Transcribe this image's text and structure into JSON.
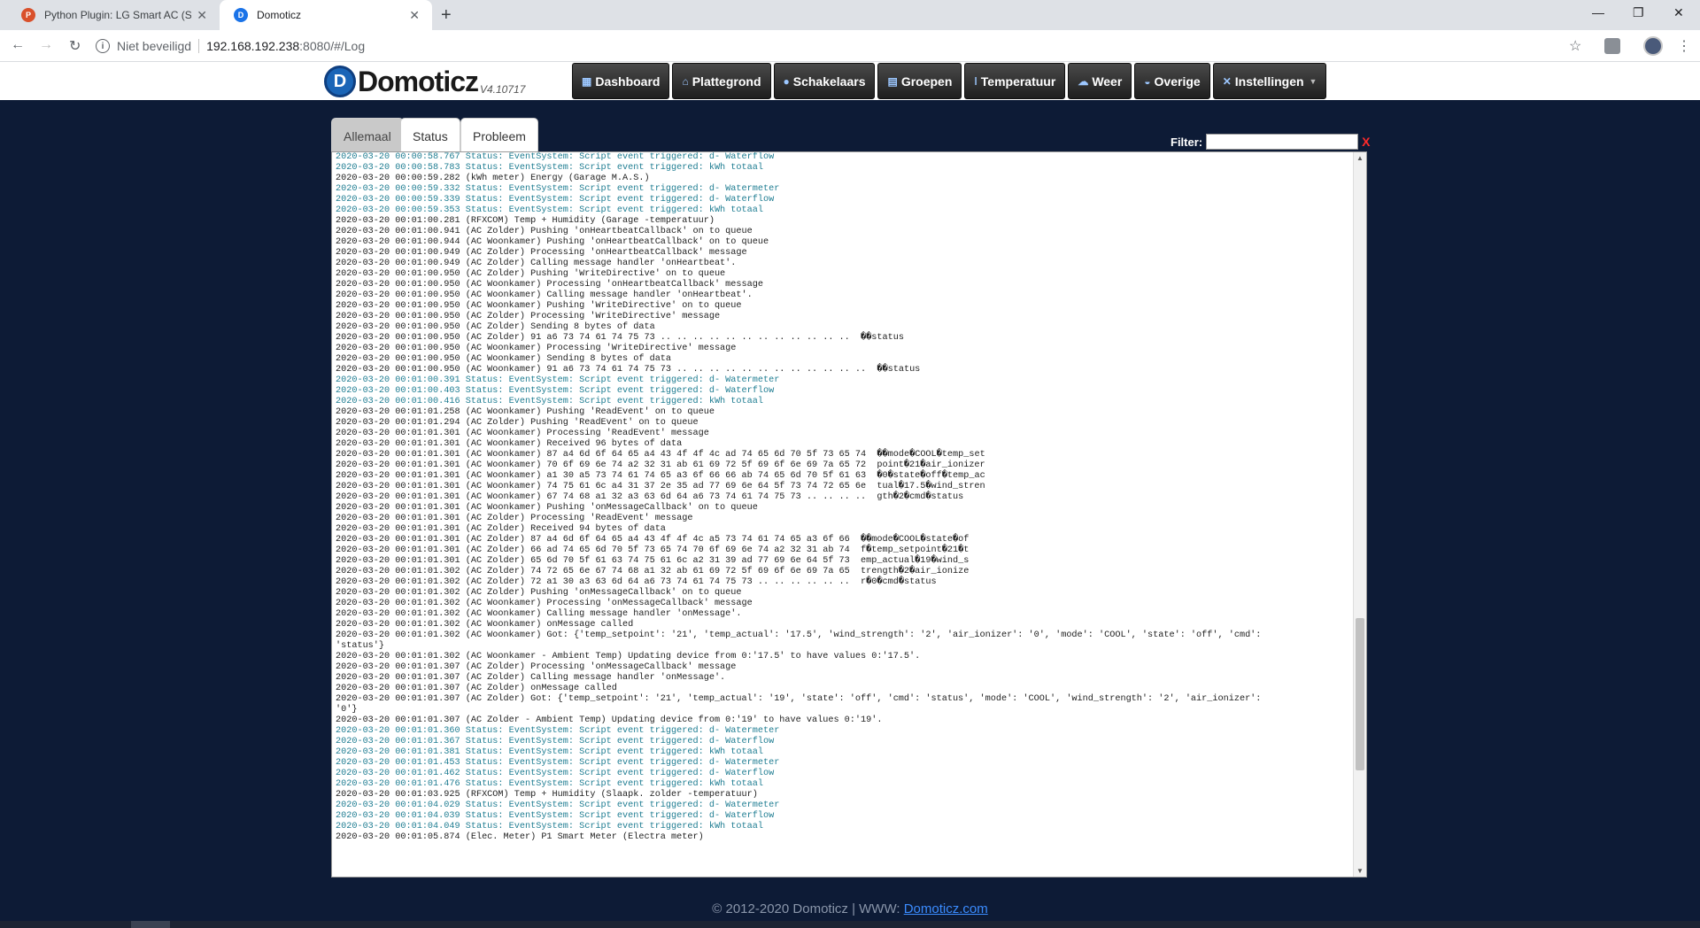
{
  "browser": {
    "tabs": [
      {
        "title": "Python Plugin: LG Smart AC (Sm",
        "favicon_color": "#d9502b"
      },
      {
        "title": "Domoticz",
        "favicon_color": "#1a73e8"
      }
    ],
    "address": {
      "security": "Niet beveiligd",
      "host": "192.168.192.238",
      "path": ":8080/#/Log"
    }
  },
  "header": {
    "logo": "Domoticz",
    "version": "V4.10717",
    "nav": [
      {
        "label": "Dashboard",
        "icon": "dashboard-icon",
        "glyph": "▦"
      },
      {
        "label": "Plattegrond",
        "icon": "floorplan-icon",
        "glyph": "⌂"
      },
      {
        "label": "Schakelaars",
        "icon": "lightbulb-icon",
        "glyph": "●"
      },
      {
        "label": "Groepen",
        "icon": "scenes-icon",
        "glyph": "▤"
      },
      {
        "label": "Temperatuur",
        "icon": "thermometer-icon",
        "glyph": "ǀ"
      },
      {
        "label": "Weer",
        "icon": "weather-icon",
        "glyph": "☁"
      },
      {
        "label": "Overige",
        "icon": "utility-icon",
        "glyph": "◒"
      },
      {
        "label": "Instellingen",
        "icon": "settings-icon",
        "glyph": "✕",
        "dropdown": true
      }
    ]
  },
  "log": {
    "tabs": [
      "Allemaal",
      "Status",
      "Probleem"
    ],
    "active_tab": 0,
    "filter_label": "Filter:",
    "filter_value": "",
    "clear_label": "X",
    "status_color": "#1f7d92",
    "lines": [
      {
        "t": "2020-03-20 00:00:58.767 Status: EventSystem: Script event triggered: d- Waterflow",
        "s": true
      },
      {
        "t": "2020-03-20 00:00:58.783 Status: EventSystem: Script event triggered: kWh totaal",
        "s": true
      },
      {
        "t": "2020-03-20 00:00:59.282 (kWh meter) Energy (Garage M.A.S.)",
        "s": false
      },
      {
        "t": "2020-03-20 00:00:59.332 Status: EventSystem: Script event triggered: d- Watermeter",
        "s": true
      },
      {
        "t": "2020-03-20 00:00:59.339 Status: EventSystem: Script event triggered: d- Waterflow",
        "s": true
      },
      {
        "t": "2020-03-20 00:00:59.353 Status: EventSystem: Script event triggered: kWh totaal",
        "s": true
      },
      {
        "t": "2020-03-20 00:01:00.281 (RFXCOM) Temp + Humidity (Garage -temperatuur)",
        "s": false
      },
      {
        "t": "2020-03-20 00:01:00.941 (AC Zolder) Pushing 'onHeartbeatCallback' on to queue",
        "s": false
      },
      {
        "t": "2020-03-20 00:01:00.944 (AC Woonkamer) Pushing 'onHeartbeatCallback' on to queue",
        "s": false
      },
      {
        "t": "2020-03-20 00:01:00.949 (AC Zolder) Processing 'onHeartbeatCallback' message",
        "s": false
      },
      {
        "t": "2020-03-20 00:01:00.949 (AC Zolder) Calling message handler 'onHeartbeat'.",
        "s": false
      },
      {
        "t": "2020-03-20 00:01:00.950 (AC Zolder) Pushing 'WriteDirective' on to queue",
        "s": false
      },
      {
        "t": "2020-03-20 00:01:00.950 (AC Woonkamer) Processing 'onHeartbeatCallback' message",
        "s": false
      },
      {
        "t": "2020-03-20 00:01:00.950 (AC Woonkamer) Calling message handler 'onHeartbeat'.",
        "s": false
      },
      {
        "t": "2020-03-20 00:01:00.950 (AC Woonkamer) Pushing 'WriteDirective' on to queue",
        "s": false
      },
      {
        "t": "2020-03-20 00:01:00.950 (AC Zolder) Processing 'WriteDirective' message",
        "s": false
      },
      {
        "t": "2020-03-20 00:01:00.950 (AC Zolder) Sending 8 bytes of data",
        "s": false
      },
      {
        "t": "2020-03-20 00:01:00.950 (AC Zolder) 91 a6 73 74 61 74 75 73 .. .. .. .. .. .. .. .. .. .. .. ..  ��status",
        "s": false
      },
      {
        "t": "2020-03-20 00:01:00.950 (AC Woonkamer) Processing 'WriteDirective' message",
        "s": false
      },
      {
        "t": "2020-03-20 00:01:00.950 (AC Woonkamer) Sending 8 bytes of data",
        "s": false
      },
      {
        "t": "2020-03-20 00:01:00.950 (AC Woonkamer) 91 a6 73 74 61 74 75 73 .. .. .. .. .. .. .. .. .. .. .. ..  ��status",
        "s": false
      },
      {
        "t": "2020-03-20 00:01:00.391 Status: EventSystem: Script event triggered: d- Watermeter",
        "s": true
      },
      {
        "t": "2020-03-20 00:01:00.403 Status: EventSystem: Script event triggered: d- Waterflow",
        "s": true
      },
      {
        "t": "2020-03-20 00:01:00.416 Status: EventSystem: Script event triggered: kWh totaal",
        "s": true
      },
      {
        "t": "2020-03-20 00:01:01.258 (AC Woonkamer) Pushing 'ReadEvent' on to queue",
        "s": false
      },
      {
        "t": "2020-03-20 00:01:01.294 (AC Zolder) Pushing 'ReadEvent' on to queue",
        "s": false
      },
      {
        "t": "2020-03-20 00:01:01.301 (AC Woonkamer) Processing 'ReadEvent' message",
        "s": false
      },
      {
        "t": "2020-03-20 00:01:01.301 (AC Woonkamer) Received 96 bytes of data",
        "s": false
      },
      {
        "t": "2020-03-20 00:01:01.301 (AC Woonkamer) 87 a4 6d 6f 64 65 a4 43 4f 4f 4c ad 74 65 6d 70 5f 73 65 74  ��mode�COOL�temp_set",
        "s": false
      },
      {
        "t": "2020-03-20 00:01:01.301 (AC Woonkamer) 70 6f 69 6e 74 a2 32 31 ab 61 69 72 5f 69 6f 6e 69 7a 65 72  point�21�air_ionizer",
        "s": false
      },
      {
        "t": "2020-03-20 00:01:01.301 (AC Woonkamer) a1 30 a5 73 74 61 74 65 a3 6f 66 66 ab 74 65 6d 70 5f 61 63  �0�state�off�temp_ac",
        "s": false
      },
      {
        "t": "2020-03-20 00:01:01.301 (AC Woonkamer) 74 75 61 6c a4 31 37 2e 35 ad 77 69 6e 64 5f 73 74 72 65 6e  tual�17.5�wind_stren",
        "s": false
      },
      {
        "t": "2020-03-20 00:01:01.301 (AC Woonkamer) 67 74 68 a1 32 a3 63 6d 64 a6 73 74 61 74 75 73 .. .. .. ..  gth�2�cmd�status",
        "s": false
      },
      {
        "t": "2020-03-20 00:01:01.301 (AC Woonkamer) Pushing 'onMessageCallback' on to queue",
        "s": false
      },
      {
        "t": "2020-03-20 00:01:01.301 (AC Zolder) Processing 'ReadEvent' message",
        "s": false
      },
      {
        "t": "2020-03-20 00:01:01.301 (AC Zolder) Received 94 bytes of data",
        "s": false
      },
      {
        "t": "2020-03-20 00:01:01.301 (AC Zolder) 87 a4 6d 6f 64 65 a4 43 4f 4f 4c a5 73 74 61 74 65 a3 6f 66  ��mode�COOL�state�of",
        "s": false
      },
      {
        "t": "2020-03-20 00:01:01.301 (AC Zolder) 66 ad 74 65 6d 70 5f 73 65 74 70 6f 69 6e 74 a2 32 31 ab 74  f�temp_setpoint�21�t",
        "s": false
      },
      {
        "t": "2020-03-20 00:01:01.301 (AC Zolder) 65 6d 70 5f 61 63 74 75 61 6c a2 31 39 ad 77 69 6e 64 5f 73  emp_actual�19�wind_s",
        "s": false
      },
      {
        "t": "2020-03-20 00:01:01.302 (AC Zolder) 74 72 65 6e 67 74 68 a1 32 ab 61 69 72 5f 69 6f 6e 69 7a 65  trength�2�air_ionize",
        "s": false
      },
      {
        "t": "2020-03-20 00:01:01.302 (AC Zolder) 72 a1 30 a3 63 6d 64 a6 73 74 61 74 75 73 .. .. .. .. .. ..  r�0�cmd�status",
        "s": false
      },
      {
        "t": "2020-03-20 00:01:01.302 (AC Zolder) Pushing 'onMessageCallback' on to queue",
        "s": false
      },
      {
        "t": "2020-03-20 00:01:01.302 (AC Woonkamer) Processing 'onMessageCallback' message",
        "s": false
      },
      {
        "t": "2020-03-20 00:01:01.302 (AC Woonkamer) Calling message handler 'onMessage'.",
        "s": false
      },
      {
        "t": "2020-03-20 00:01:01.302 (AC Woonkamer) onMessage called",
        "s": false
      },
      {
        "t": "2020-03-20 00:01:01.302 (AC Woonkamer) Got: {'temp_setpoint': '21', 'temp_actual': '17.5', 'wind_strength': '2', 'air_ionizer': '0', 'mode': 'COOL', 'state': 'off', 'cmd':",
        "s": false
      },
      {
        "t": "'status'}",
        "s": false
      },
      {
        "t": "2020-03-20 00:01:01.302 (AC Woonkamer - Ambient Temp) Updating device from 0:'17.5' to have values 0:'17.5'.",
        "s": false
      },
      {
        "t": "2020-03-20 00:01:01.307 (AC Zolder) Processing 'onMessageCallback' message",
        "s": false
      },
      {
        "t": "2020-03-20 00:01:01.307 (AC Zolder) Calling message handler 'onMessage'.",
        "s": false
      },
      {
        "t": "2020-03-20 00:01:01.307 (AC Zolder) onMessage called",
        "s": false
      },
      {
        "t": "2020-03-20 00:01:01.307 (AC Zolder) Got: {'temp_setpoint': '21', 'temp_actual': '19', 'state': 'off', 'cmd': 'status', 'mode': 'COOL', 'wind_strength': '2', 'air_ionizer':",
        "s": false
      },
      {
        "t": "'0'}",
        "s": false
      },
      {
        "t": "2020-03-20 00:01:01.307 (AC Zolder - Ambient Temp) Updating device from 0:'19' to have values 0:'19'.",
        "s": false
      },
      {
        "t": "2020-03-20 00:01:01.360 Status: EventSystem: Script event triggered: d- Watermeter",
        "s": true
      },
      {
        "t": "2020-03-20 00:01:01.367 Status: EventSystem: Script event triggered: d- Waterflow",
        "s": true
      },
      {
        "t": "2020-03-20 00:01:01.381 Status: EventSystem: Script event triggered: kWh totaal",
        "s": true
      },
      {
        "t": "2020-03-20 00:01:01.453 Status: EventSystem: Script event triggered: d- Watermeter",
        "s": true
      },
      {
        "t": "2020-03-20 00:01:01.462 Status: EventSystem: Script event triggered: d- Waterflow",
        "s": true
      },
      {
        "t": "2020-03-20 00:01:01.476 Status: EventSystem: Script event triggered: kWh totaal",
        "s": true
      },
      {
        "t": "2020-03-20 00:01:03.925 (RFXCOM) Temp + Humidity (Slaapk. zolder -temperatuur)",
        "s": false
      },
      {
        "t": "2020-03-20 00:01:04.029 Status: EventSystem: Script event triggered: d- Watermeter",
        "s": true
      },
      {
        "t": "2020-03-20 00:01:04.039 Status: EventSystem: Script event triggered: d- Waterflow",
        "s": true
      },
      {
        "t": "2020-03-20 00:01:04.049 Status: EventSystem: Script event triggered: kWh totaal",
        "s": true
      },
      {
        "t": "2020-03-20 00:01:05.874 (Elec. Meter) P1 Smart Meter (Electra meter)",
        "s": false
      }
    ]
  },
  "footer": {
    "text": "© 2012-2020 Domoticz | WWW: ",
    "link": "Domoticz.com"
  }
}
